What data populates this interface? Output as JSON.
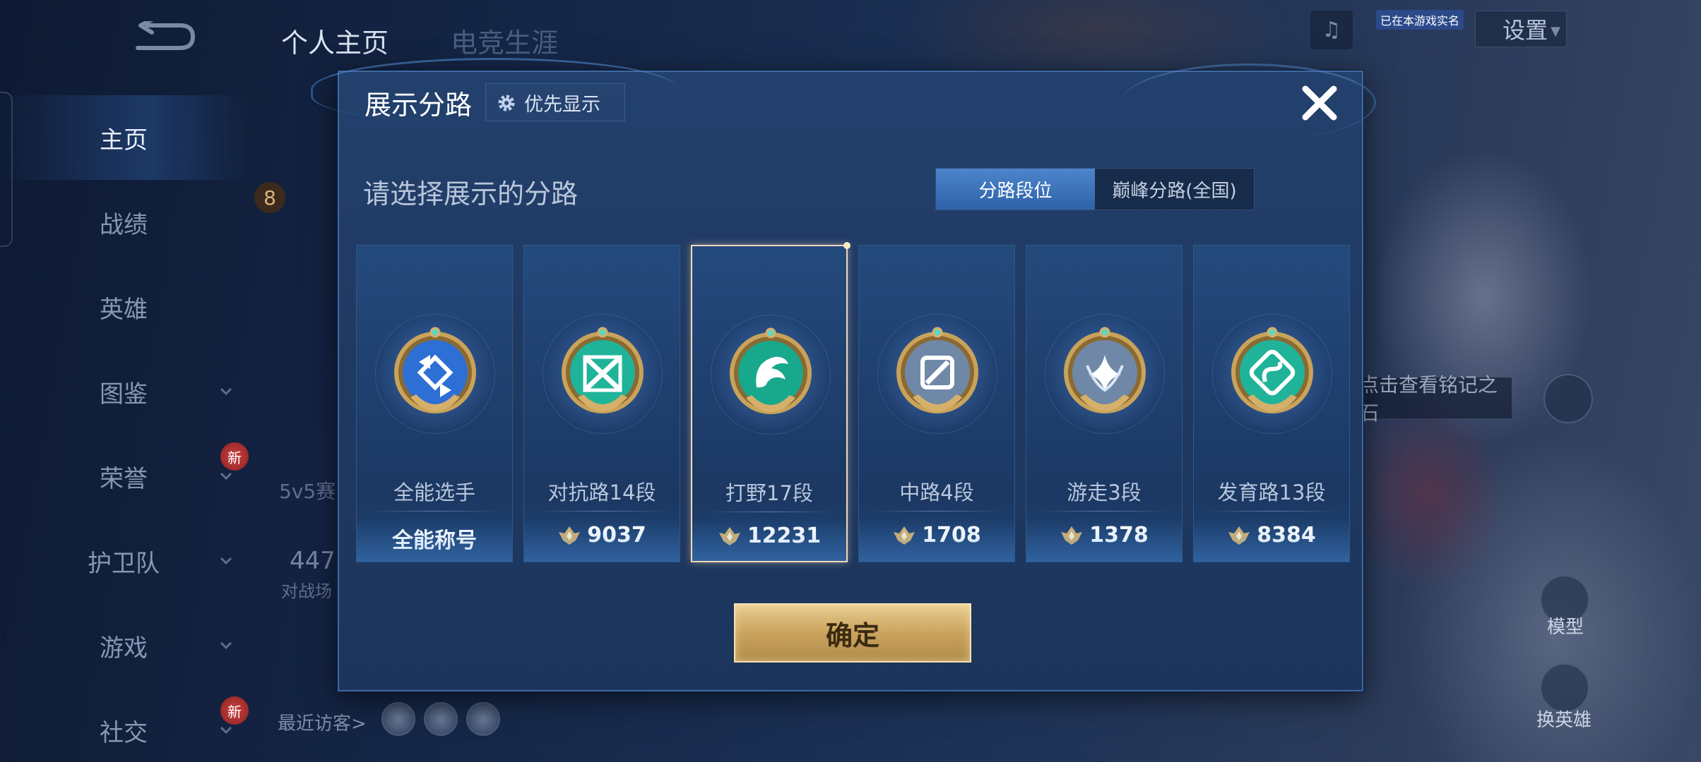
{
  "top_tabs": {
    "profile": "个人主页",
    "esports": "电竞生涯"
  },
  "nav": {
    "items": [
      {
        "label": "主页",
        "active": true,
        "chevron": false,
        "new": false
      },
      {
        "label": "战绩",
        "active": false,
        "chevron": false,
        "new": false
      },
      {
        "label": "英雄",
        "active": false,
        "chevron": false,
        "new": false
      },
      {
        "label": "图鉴",
        "active": false,
        "chevron": true,
        "new": false
      },
      {
        "label": "荣誉",
        "active": false,
        "chevron": true,
        "new": true
      },
      {
        "label": "护卫队",
        "active": false,
        "chevron": true,
        "new": false
      },
      {
        "label": "游戏",
        "active": false,
        "chevron": true,
        "new": false
      },
      {
        "label": "社交",
        "active": false,
        "chevron": true,
        "new": true
      }
    ],
    "new_badge": "新"
  },
  "header_right": {
    "game_tag": "已在本游戏实名",
    "settings_label": "设置"
  },
  "background": {
    "level": "8",
    "mode_text": "5v5赛",
    "match_count": "447",
    "match_label": "对战场",
    "recent_visitors": "最近访客>",
    "inscription_tip": "点击查看铭记之石",
    "model_label": "模型",
    "change_hero_label": "换英雄"
  },
  "modal": {
    "title": "展示分路",
    "priority_button": "优先显示",
    "subtitle": "请选择展示的分路",
    "segments": [
      {
        "label": "分路段位",
        "active": true
      },
      {
        "label": "巅峰分路(全国)",
        "active": false
      }
    ],
    "cards": [
      {
        "name": "全能选手",
        "score": "全能称号",
        "emblem": "all-round-emblem-icon",
        "show_score_icon": false,
        "selected": false,
        "emblem_color": "#2e6fd6"
      },
      {
        "name": "对抗路14段",
        "score": "9037",
        "emblem": "clash-lane-emblem-icon",
        "show_score_icon": true,
        "selected": false,
        "emblem_color": "#1fb39a"
      },
      {
        "name": "打野17段",
        "score": "12231",
        "emblem": "jungle-emblem-icon",
        "show_score_icon": true,
        "selected": true,
        "emblem_color": "#18a88c"
      },
      {
        "name": "中路4段",
        "score": "1708",
        "emblem": "mid-lane-emblem-icon",
        "show_score_icon": true,
        "selected": false,
        "emblem_color": "#6f88a8"
      },
      {
        "name": "游走3段",
        "score": "1378",
        "emblem": "roam-emblem-icon",
        "show_score_icon": true,
        "selected": false,
        "emblem_color": "#6f88a8"
      },
      {
        "name": "发育路13段",
        "score": "8384",
        "emblem": "farm-lane-emblem-icon",
        "show_score_icon": true,
        "selected": false,
        "emblem_color": "#1fb39a"
      }
    ],
    "confirm_button": "确定"
  },
  "colors": {
    "gold": "#d6b06a",
    "accent_blue": "#3f73bf",
    "selected_border": "#f0d9ba"
  }
}
